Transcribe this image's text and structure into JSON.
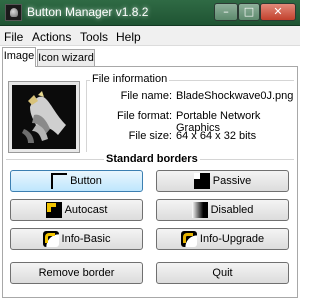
{
  "window": {
    "title": "Button Manager v1.8.2",
    "controls": {
      "minimize": "–",
      "maximize": "□",
      "close": "✕"
    },
    "close_color": "#c2412d"
  },
  "menu": [
    "File",
    "Actions",
    "Tools",
    "Help"
  ],
  "tabs": [
    {
      "label": "Image",
      "active": true
    },
    {
      "label": "Icon wizard",
      "active": false
    }
  ],
  "file_info": {
    "title": "File information",
    "rows": [
      {
        "label": "File name:",
        "value": "BladeShockwave0J.png"
      },
      {
        "label": "File format:",
        "value": "Portable Network Graphics"
      },
      {
        "label": "File size:",
        "value": "64 x 64 x 32 bits"
      }
    ]
  },
  "standard_borders": {
    "title": "Standard borders",
    "buttons": [
      {
        "label": "Button",
        "icon": "button-border-icon"
      },
      {
        "label": "Passive",
        "icon": "passive-border-icon"
      },
      {
        "label": "Autocast",
        "icon": "autocast-border-icon"
      },
      {
        "label": "Disabled",
        "icon": "disabled-border-icon"
      },
      {
        "label": "Info-Basic",
        "icon": "info-basic-border-icon"
      },
      {
        "label": "Info-Upgrade",
        "icon": "info-upgrade-border-icon"
      }
    ]
  },
  "actions": {
    "remove_border": "Remove border",
    "quit": "Quit"
  }
}
